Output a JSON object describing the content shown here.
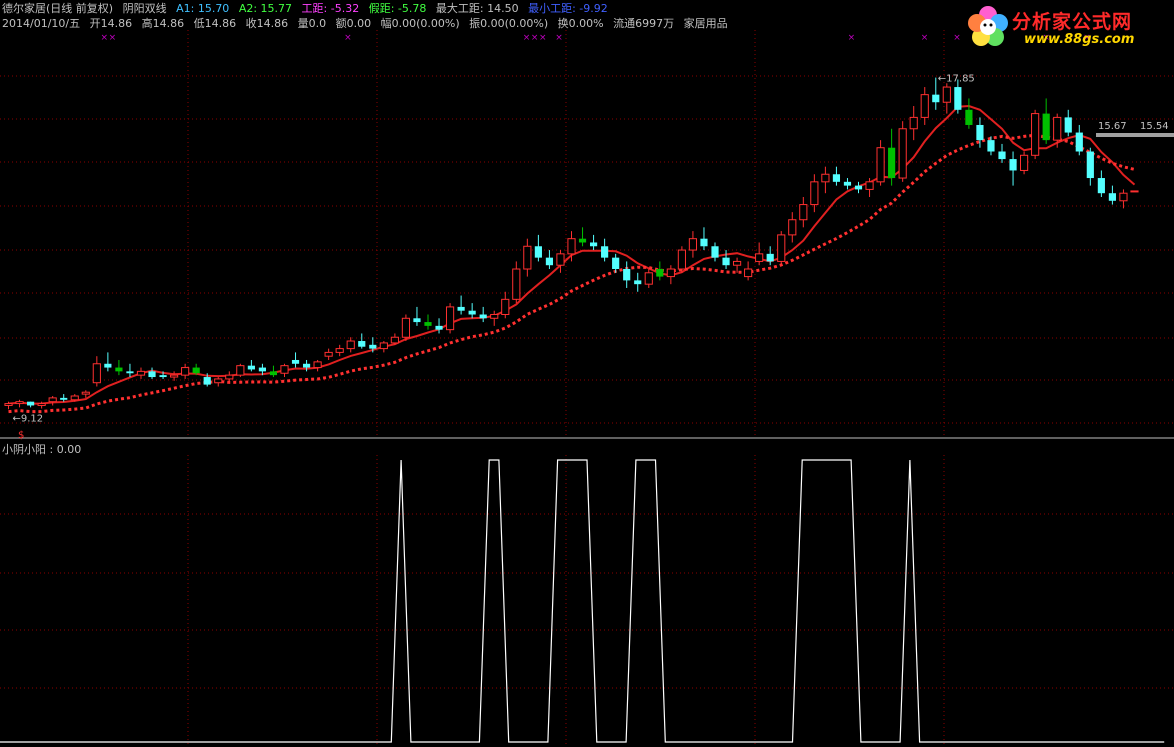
{
  "header": {
    "title": "德尔家居(日线 前复权)",
    "indicator_name": "阴阳双线",
    "a1": "A1: 15.70",
    "a2": "A2: 15.77",
    "gongju": "工距: -5.32",
    "jiaju": "假距: -5.78",
    "max_gongju": "最大工距: 14.50",
    "min_gongju": "最小工距: -9.92",
    "date_bar": "2014/01/10/五",
    "open": "开14.86",
    "high": "高14.86",
    "low": "低14.86",
    "close": "收14.86",
    "volume": "量0.0",
    "amount": "额0.00",
    "change": "幅0.00(0.00%)",
    "amplitude": "振0.00(0.00%)",
    "turnover": "换0.00%",
    "float_shares": "流通6997万",
    "industry": "家居用品"
  },
  "logo": {
    "name": "分析家公式网",
    "url": "www.88gs.com"
  },
  "subchart": {
    "label": "小阴小阳 : 0.00"
  },
  "colors": {
    "up": "#ff3030",
    "down_cyan": "#54ffff",
    "down_green": "#00c000",
    "ma_red": "#e02020",
    "grid": "#8b0000",
    "text": "#c0c0c0",
    "a1_color": "#40c0ff",
    "a2_color": "#40ff40",
    "gongju_color": "#ff40ff",
    "jiaju_color": "#40ff40",
    "min_color": "#4060ff"
  },
  "chart_data": [
    {
      "type": "candlestick",
      "title": "德尔家居(日线 前复权)",
      "annotations": [
        {
          "text": "17.85",
          "type": "high"
        },
        {
          "text": "9.12",
          "type": "low"
        },
        {
          "text": "15.67",
          "type": "label"
        },
        {
          "text": "15.54",
          "type": "label"
        }
      ],
      "ylim": [
        8.5,
        19.0
      ],
      "candles": [
        [
          9.2,
          9.3,
          9.1,
          9.25
        ],
        [
          9.25,
          9.35,
          9.15,
          9.3
        ],
        [
          9.3,
          9.3,
          9.15,
          9.2
        ],
        [
          9.2,
          9.3,
          9.12,
          9.25
        ],
        [
          9.3,
          9.45,
          9.2,
          9.4
        ],
        [
          9.4,
          9.5,
          9.3,
          9.35
        ],
        [
          9.35,
          9.5,
          9.3,
          9.45
        ],
        [
          9.5,
          9.6,
          9.4,
          9.55
        ],
        [
          9.8,
          10.5,
          9.7,
          10.3
        ],
        [
          10.3,
          10.6,
          10.1,
          10.2
        ],
        [
          10.2,
          10.4,
          10.0,
          10.1
        ],
        [
          10.1,
          10.3,
          9.95,
          10.05
        ],
        [
          10.0,
          10.2,
          9.9,
          10.1
        ],
        [
          10.1,
          10.2,
          9.9,
          9.95
        ],
        [
          10.0,
          10.1,
          9.9,
          9.95
        ],
        [
          9.95,
          10.1,
          9.85,
          10.0
        ],
        [
          10.0,
          10.3,
          9.9,
          10.2
        ],
        [
          10.2,
          10.3,
          10.0,
          10.05
        ],
        [
          9.95,
          10.05,
          9.7,
          9.75
        ],
        [
          9.8,
          9.95,
          9.7,
          9.9
        ],
        [
          9.9,
          10.1,
          9.8,
          10.0
        ],
        [
          10.0,
          10.3,
          9.95,
          10.25
        ],
        [
          10.25,
          10.4,
          10.1,
          10.15
        ],
        [
          10.2,
          10.3,
          10.0,
          10.1
        ],
        [
          10.1,
          10.25,
          9.95,
          10.0
        ],
        [
          10.05,
          10.3,
          9.95,
          10.25
        ],
        [
          10.4,
          10.6,
          10.2,
          10.3
        ],
        [
          10.3,
          10.4,
          10.1,
          10.2
        ],
        [
          10.2,
          10.4,
          10.1,
          10.35
        ],
        [
          10.5,
          10.7,
          10.4,
          10.6
        ],
        [
          10.6,
          10.8,
          10.5,
          10.7
        ],
        [
          10.7,
          11.0,
          10.6,
          10.9
        ],
        [
          10.9,
          11.1,
          10.7,
          10.75
        ],
        [
          10.8,
          11.0,
          10.6,
          10.7
        ],
        [
          10.7,
          10.9,
          10.6,
          10.85
        ],
        [
          10.85,
          11.1,
          10.8,
          11.0
        ],
        [
          11.0,
          11.6,
          10.9,
          11.5
        ],
        [
          11.5,
          11.8,
          11.3,
          11.4
        ],
        [
          11.4,
          11.6,
          11.2,
          11.3
        ],
        [
          11.3,
          11.5,
          11.1,
          11.2
        ],
        [
          11.2,
          11.9,
          11.1,
          11.8
        ],
        [
          11.8,
          12.1,
          11.6,
          11.7
        ],
        [
          11.7,
          11.9,
          11.5,
          11.6
        ],
        [
          11.6,
          11.8,
          11.4,
          11.5
        ],
        [
          11.5,
          11.7,
          11.3,
          11.6
        ],
        [
          11.6,
          12.2,
          11.5,
          12.0
        ],
        [
          12.0,
          13.0,
          11.9,
          12.8
        ],
        [
          12.8,
          13.6,
          12.6,
          13.4
        ],
        [
          13.4,
          13.7,
          13.0,
          13.1
        ],
        [
          13.1,
          13.3,
          12.8,
          12.9
        ],
        [
          12.9,
          13.3,
          12.7,
          13.2
        ],
        [
          13.2,
          13.8,
          13.0,
          13.6
        ],
        [
          13.6,
          13.9,
          13.4,
          13.5
        ],
        [
          13.5,
          13.7,
          13.3,
          13.4
        ],
        [
          13.4,
          13.6,
          13.0,
          13.1
        ],
        [
          13.1,
          13.2,
          12.7,
          12.8
        ],
        [
          12.8,
          13.0,
          12.3,
          12.5
        ],
        [
          12.5,
          12.7,
          12.2,
          12.4
        ],
        [
          12.4,
          12.8,
          12.3,
          12.7
        ],
        [
          12.8,
          13.0,
          12.5,
          12.6
        ],
        [
          12.6,
          12.9,
          12.4,
          12.8
        ],
        [
          12.8,
          13.4,
          12.7,
          13.3
        ],
        [
          13.3,
          13.8,
          13.1,
          13.6
        ],
        [
          13.6,
          13.9,
          13.3,
          13.4
        ],
        [
          13.4,
          13.5,
          13.0,
          13.1
        ],
        [
          13.1,
          13.3,
          12.8,
          12.9
        ],
        [
          12.9,
          13.1,
          12.7,
          13.0
        ],
        [
          12.6,
          13.0,
          12.5,
          12.8
        ],
        [
          13.0,
          13.5,
          12.9,
          13.2
        ],
        [
          13.2,
          13.4,
          12.9,
          13.0
        ],
        [
          13.0,
          13.8,
          12.9,
          13.7
        ],
        [
          13.7,
          14.3,
          13.5,
          14.1
        ],
        [
          14.1,
          14.7,
          13.9,
          14.5
        ],
        [
          14.5,
          15.3,
          14.3,
          15.1
        ],
        [
          15.1,
          15.5,
          14.8,
          15.3
        ],
        [
          15.3,
          15.5,
          15.0,
          15.1
        ],
        [
          15.1,
          15.2,
          14.9,
          15.0
        ],
        [
          15.0,
          15.1,
          14.8,
          14.9
        ],
        [
          14.9,
          15.2,
          14.7,
          15.1
        ],
        [
          15.1,
          16.2,
          15.0,
          16.0
        ],
        [
          16.0,
          16.5,
          15.0,
          15.2
        ],
        [
          15.2,
          16.7,
          15.1,
          16.5
        ],
        [
          16.5,
          17.1,
          16.2,
          16.8
        ],
        [
          16.8,
          17.6,
          16.6,
          17.4
        ],
        [
          17.4,
          17.85,
          17.0,
          17.2
        ],
        [
          17.2,
          17.7,
          16.9,
          17.6
        ],
        [
          17.6,
          17.8,
          16.9,
          17.0
        ],
        [
          17.0,
          17.3,
          16.5,
          16.6
        ],
        [
          16.6,
          16.8,
          16.0,
          16.2
        ],
        [
          16.2,
          16.3,
          15.8,
          15.9
        ],
        [
          15.9,
          16.1,
          15.6,
          15.7
        ],
        [
          15.7,
          15.9,
          15.0,
          15.4
        ],
        [
          15.4,
          15.9,
          15.3,
          15.8
        ],
        [
          15.8,
          17.0,
          15.7,
          16.9
        ],
        [
          16.9,
          17.3,
          16.1,
          16.2
        ],
        [
          16.2,
          16.9,
          16.0,
          16.8
        ],
        [
          16.8,
          17.0,
          16.3,
          16.4
        ],
        [
          16.4,
          16.6,
          15.8,
          15.9
        ],
        [
          15.9,
          16.0,
          15.0,
          15.2
        ],
        [
          15.2,
          15.4,
          14.7,
          14.8
        ],
        [
          14.8,
          15.0,
          14.5,
          14.6
        ],
        [
          14.6,
          14.9,
          14.4,
          14.8
        ],
        [
          14.86,
          14.86,
          14.86,
          14.86
        ]
      ]
    },
    {
      "type": "line",
      "title": "小阴小阳 : 0.00",
      "ylim": [
        0,
        1
      ],
      "values": [
        0,
        0,
        0,
        0,
        0,
        0,
        0,
        0,
        0,
        0,
        0,
        0,
        0,
        0,
        0,
        0,
        0,
        0,
        0,
        0,
        0,
        0,
        0,
        0,
        0,
        0,
        0,
        0,
        0,
        0,
        0,
        0,
        0,
        0,
        0,
        0,
        0,
        0,
        0,
        0,
        0,
        1,
        0,
        0,
        0,
        0,
        0,
        0,
        0,
        0,
        1,
        1,
        0,
        0,
        0,
        0,
        0,
        1,
        1,
        1,
        1,
        0,
        0,
        0,
        0,
        1,
        1,
        1,
        0,
        0,
        0,
        0,
        0,
        0,
        0,
        0,
        0,
        0,
        0,
        0,
        0,
        0,
        1,
        1,
        1,
        1,
        1,
        1,
        0,
        0,
        0,
        0,
        0,
        1,
        0,
        0,
        0,
        0,
        0,
        0,
        0,
        0,
        0,
        0,
        0,
        0,
        0,
        0,
        0,
        0,
        0,
        0,
        0,
        0,
        0,
        0,
        0,
        0,
        0,
        0
      ]
    }
  ]
}
